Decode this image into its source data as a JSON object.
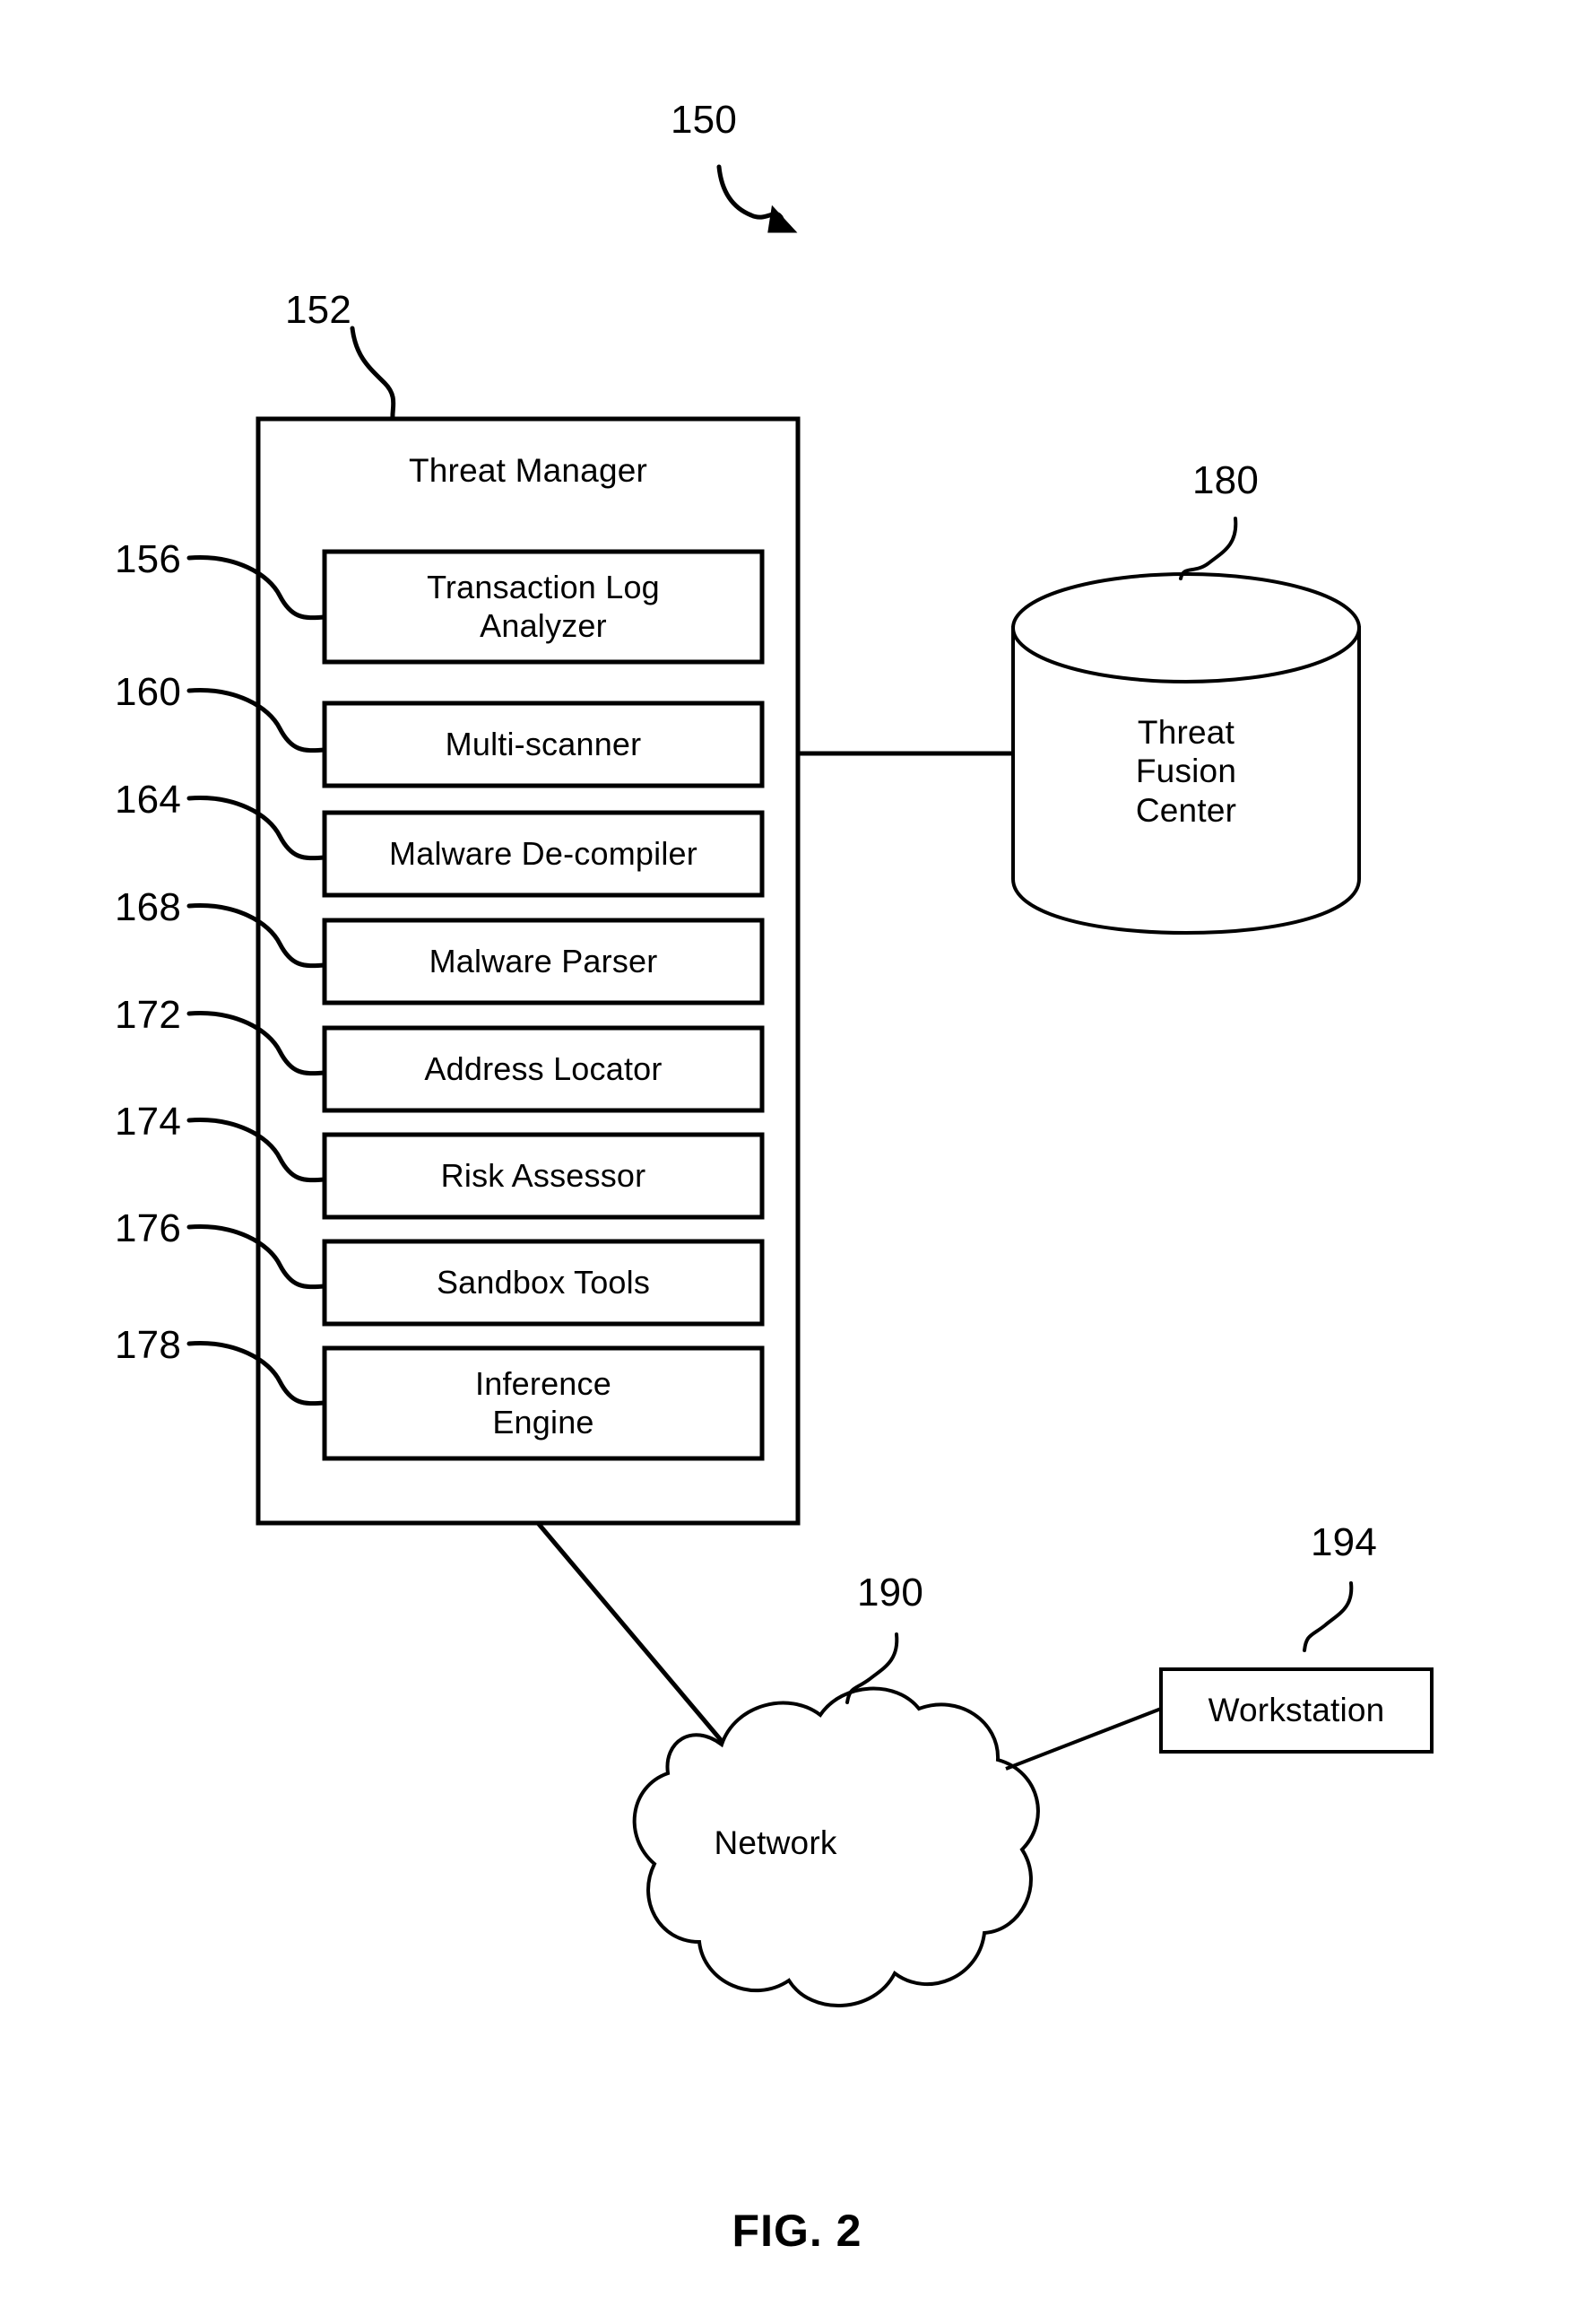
{
  "figure": {
    "caption": "FIG. 2",
    "system_ref": "150"
  },
  "threat_manager": {
    "ref": "152",
    "title": "Threat Manager",
    "modules": [
      {
        "ref": "156",
        "label": "Transaction Log\nAnalyzer"
      },
      {
        "ref": "160",
        "label": "Multi-scanner"
      },
      {
        "ref": "164",
        "label": "Malware De-compiler"
      },
      {
        "ref": "168",
        "label": "Malware Parser"
      },
      {
        "ref": "172",
        "label": "Address Locator"
      },
      {
        "ref": "174",
        "label": "Risk Assessor"
      },
      {
        "ref": "176",
        "label": "Sandbox Tools"
      },
      {
        "ref": "178",
        "label": "Inference\nEngine"
      }
    ]
  },
  "threat_fusion_center": {
    "ref": "180",
    "label": "Threat\nFusion\nCenter"
  },
  "network": {
    "ref": "190",
    "label": "Network"
  },
  "workstation": {
    "ref": "194",
    "label": "Workstation"
  },
  "style": {
    "line_color": "#000000",
    "background": "#ffffff"
  }
}
